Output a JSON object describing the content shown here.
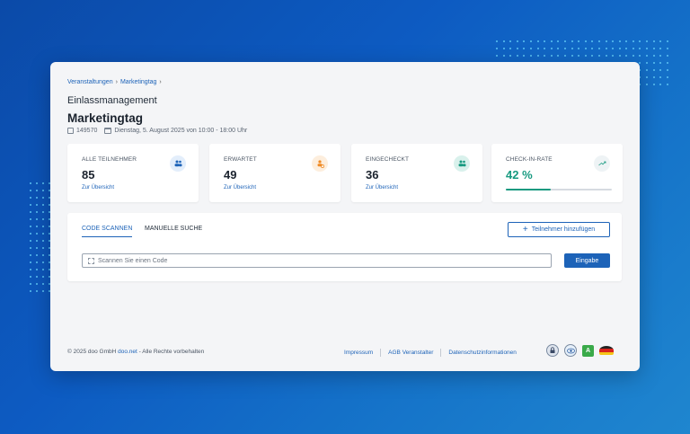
{
  "breadcrumb": [
    "Veranstaltungen",
    "Marketingtag"
  ],
  "section_title": "Einlassmanagement",
  "event": {
    "title": "Marketingtag",
    "id": "149570",
    "date": "Dienstag, 5. August 2025 von 10:00 - 18:00 Uhr"
  },
  "stats": [
    {
      "label": "ALLE TEILNEHMER",
      "value": "85",
      "link": "Zur Übersicht",
      "icon": "people-icon",
      "color": "#1d63b8"
    },
    {
      "label": "ERWARTET",
      "value": "49",
      "link": "Zur Übersicht",
      "icon": "person-clock-icon",
      "color": "#f08a24"
    },
    {
      "label": "EINGECHECKT",
      "value": "36",
      "link": "Zur Übersicht",
      "icon": "people-check-icon",
      "color": "#179a80"
    },
    {
      "label": "CHECK-IN-RATE",
      "value": "42 %",
      "progress": 0.42,
      "icon": "trend-up-icon",
      "color": "#179a80"
    }
  ],
  "tabs": [
    {
      "label": "CODE SCANNEN",
      "active": true
    },
    {
      "label": "MANUELLE SUCHE",
      "active": false
    }
  ],
  "add_button_label": "Teilnehmer hinzufügen",
  "scan_placeholder": "Scannen Sie einen Code",
  "submit_label": "Eingabe",
  "footer": {
    "copyright_pre": "© 2025 doo GmbH",
    "brand": "doo.net",
    "copyright_post": "- Alle Rechte vorbehalten",
    "links": [
      "Impressum",
      "AGB Veranstalter",
      "Datenschutzinformationen"
    ]
  },
  "seal_a_label": "A"
}
